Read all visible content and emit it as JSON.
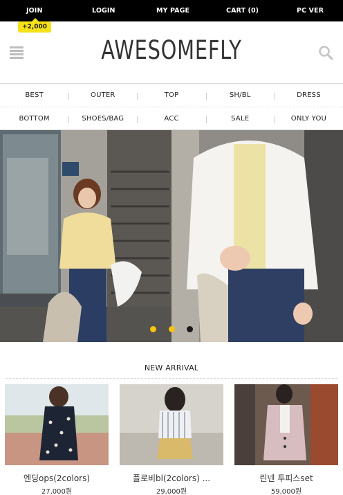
{
  "topbar": {
    "links": [
      "JOIN",
      "LOGIN",
      "MY PAGE",
      "CART (0)",
      "PC VER"
    ]
  },
  "badge": {
    "text": "+2,000"
  },
  "header": {
    "logo": "AWESOMEFLY",
    "menu_icon": "hamburger-icon",
    "search_icon": "search-icon"
  },
  "menu": {
    "row1": [
      "BEST",
      "OUTER",
      "TOP",
      "SH/BL",
      "DRESS"
    ],
    "row2": [
      "BOTTOM",
      "SHOES/BAG",
      "ACC",
      "SALE",
      "ONLY YOU"
    ]
  },
  "banner": {
    "slides": 3,
    "active_slide": 3,
    "dot_colors": {
      "inactive": "#f5c40f",
      "active": "#1a1a1a"
    }
  },
  "new_arrival": {
    "title": "NEW ARRIVAL",
    "products": [
      {
        "name": "엔딩ops(2colors)",
        "price": "27,000원",
        "tag_color": "#d8232a"
      },
      {
        "name": "플로비bl(2colors) ...",
        "price": "29,000원",
        "tag_color": "#1a1a1a"
      },
      {
        "name": "린넨 투피스set",
        "price": "59,000원",
        "tag_color": "#1a1a1a"
      }
    ]
  },
  "colors": {
    "topbar": "#000000",
    "badge": "#f5e21a"
  }
}
